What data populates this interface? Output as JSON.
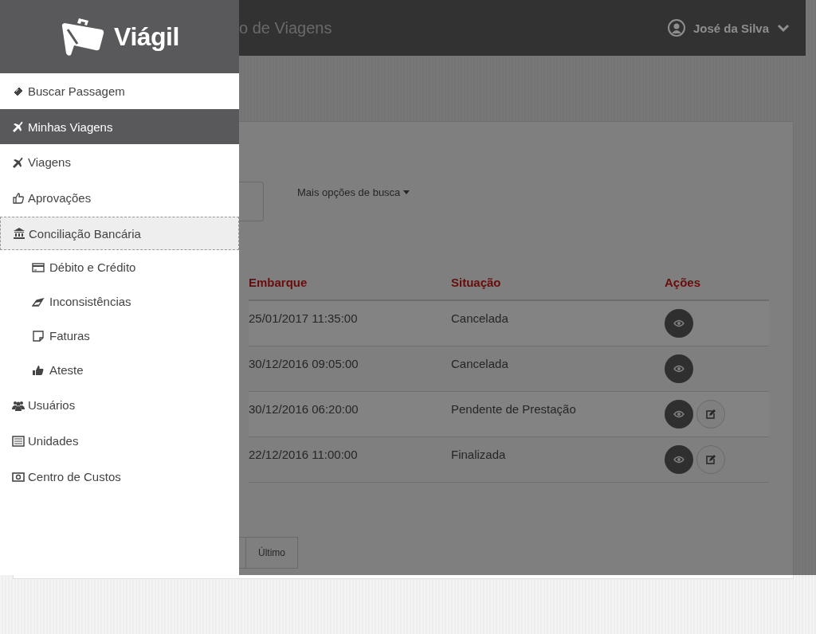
{
  "sidebar": {
    "logo": "Viágil",
    "items": [
      {
        "label": "Buscar Passagem",
        "selected": false,
        "focused": false
      },
      {
        "label": "Minhas Viagens",
        "selected": true,
        "focused": false
      },
      {
        "label": "Viagens",
        "selected": false,
        "focused": false
      },
      {
        "label": "Aprovações",
        "selected": false,
        "focused": false
      },
      {
        "label": "Conciliação Bancária",
        "selected": false,
        "focused": true,
        "children": [
          {
            "label": "Débito e Crédito",
            "selected": false,
            "focused": false
          },
          {
            "label": "Inconsistências",
            "selected": false,
            "focused": false
          },
          {
            "label": "Faturas",
            "selected": false,
            "focused": false
          },
          {
            "label": "Ateste",
            "selected": false,
            "focused": false
          }
        ]
      },
      {
        "label": "Usuários",
        "selected": false,
        "focused": false
      },
      {
        "label": "Unidades",
        "selected": false,
        "focused": false
      },
      {
        "label": "Centro de Custos",
        "selected": false,
        "focused": false
      }
    ]
  },
  "header": {
    "title": "o de Viagens",
    "user": "José da Silva"
  },
  "search": {
    "more_options": "Mais opções de busca"
  },
  "table": {
    "columns": [
      "Embarque",
      "Situação",
      "Ações"
    ],
    "rows": [
      {
        "embarque": "25/01/2017 11:35:00",
        "situacao": "Cancelada",
        "actions": [
          {
            "kind": "view"
          }
        ]
      },
      {
        "embarque": "30/12/2016 09:05:00",
        "situacao": "Cancelada",
        "actions": [
          {
            "kind": "view"
          }
        ]
      },
      {
        "embarque": "30/12/2016 06:20:00",
        "situacao": "Pendente de Prestação",
        "actions": [
          {
            "kind": "view"
          },
          {
            "kind": "edit"
          }
        ]
      },
      {
        "embarque": "22/12/2016 11:00:00",
        "situacao": "Finalizada",
        "actions": [
          {
            "kind": "view"
          },
          {
            "kind": "edit"
          }
        ]
      }
    ]
  },
  "pagination": {
    "last": "Último"
  }
}
